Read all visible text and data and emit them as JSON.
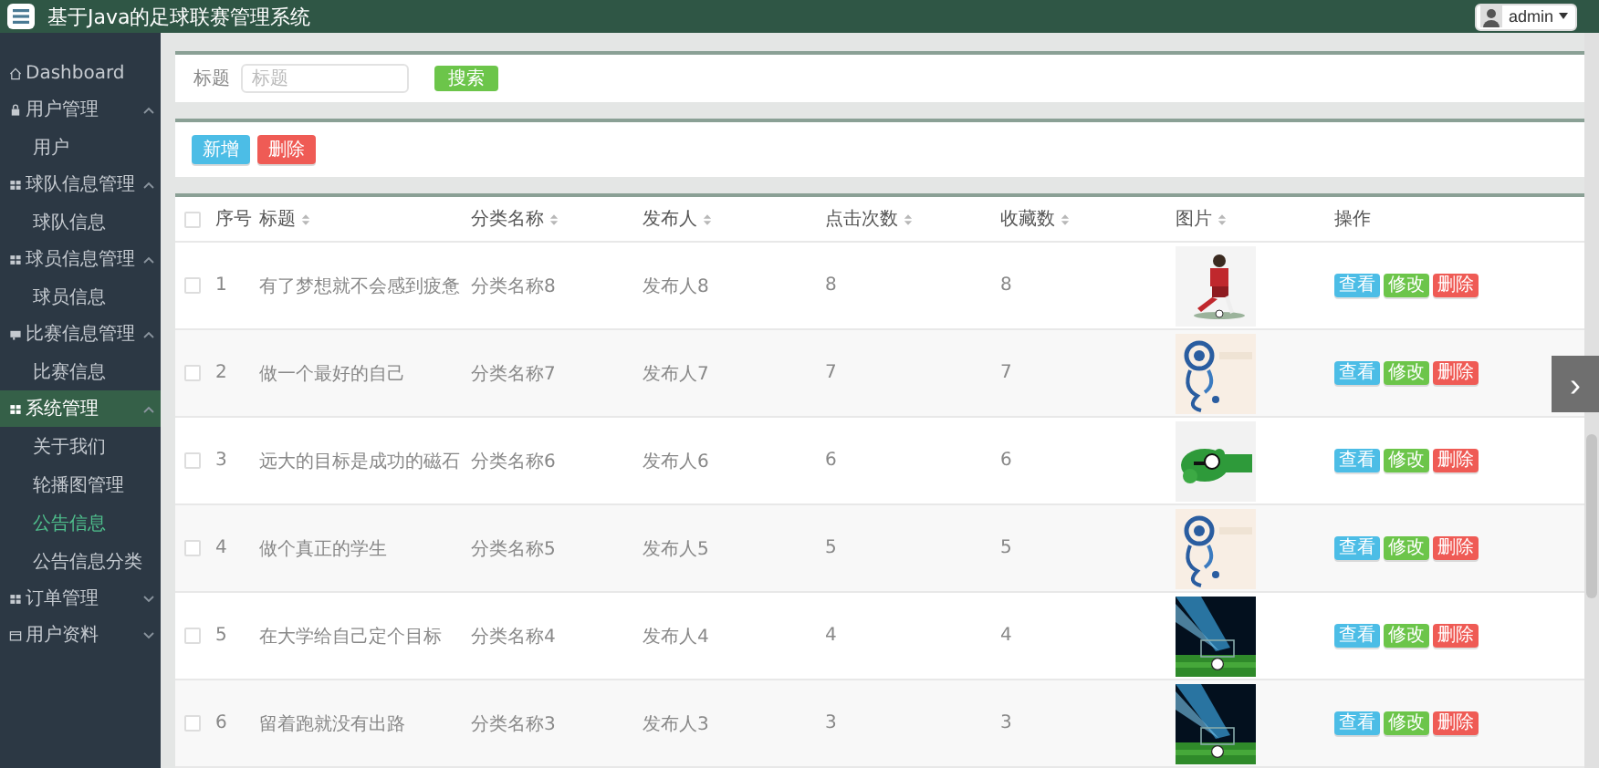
{
  "header": {
    "title": "基于Java的足球联赛管理系统",
    "user": "admin"
  },
  "sidebar": {
    "items": [
      {
        "label": "Dashboard",
        "kind": "home",
        "selected": false
      },
      {
        "label": "用户管理",
        "kind": "lock",
        "expanded": true,
        "selected": false,
        "children": [
          {
            "label": "用户",
            "selected": false
          }
        ]
      },
      {
        "label": "球队信息管理",
        "kind": "grid",
        "expanded": true,
        "selected": false,
        "children": [
          {
            "label": "球队信息",
            "selected": false
          }
        ]
      },
      {
        "label": "球员信息管理",
        "kind": "grid",
        "expanded": true,
        "selected": false,
        "children": [
          {
            "label": "球员信息",
            "selected": false
          }
        ]
      },
      {
        "label": "比赛信息管理",
        "kind": "card",
        "expanded": true,
        "selected": false,
        "children": [
          {
            "label": "比赛信息",
            "selected": false
          }
        ]
      },
      {
        "label": "系统管理",
        "kind": "grid",
        "expanded": true,
        "selected": true,
        "children": [
          {
            "label": "关于我们",
            "selected": false
          },
          {
            "label": "轮播图管理",
            "selected": false
          },
          {
            "label": "公告信息",
            "selected": true
          },
          {
            "label": "公告信息分类",
            "selected": false
          }
        ]
      },
      {
        "label": "订单管理",
        "kind": "grid",
        "expanded": false,
        "selected": false
      },
      {
        "label": "用户资料",
        "kind": "doc",
        "expanded": false,
        "selected": false
      }
    ]
  },
  "search": {
    "label": "标题",
    "placeholder": "标题",
    "button": "搜索"
  },
  "toolbar": [
    {
      "label": "新增",
      "kind": "add"
    },
    {
      "label": "删除",
      "kind": "delete"
    }
  ],
  "table": {
    "all_checked": false,
    "columns": [
      {
        "label": "序号",
        "sortable": false
      },
      {
        "label": "标题",
        "sortable": true
      },
      {
        "label": "分类名称",
        "sortable": true
      },
      {
        "label": "发布人",
        "sortable": true
      },
      {
        "label": "点击次数",
        "sortable": true
      },
      {
        "label": "收藏数",
        "sortable": true
      },
      {
        "label": "图片",
        "sortable": true
      },
      {
        "label": "操作",
        "sortable": false
      }
    ],
    "rows": [
      {
        "checked": false,
        "cells": [
          "1",
          "有了梦想就不会感到疲惫",
          "分类名称8",
          "发布人8",
          "8",
          "8"
        ],
        "image": {
          "kind": "picture"
        },
        "actions": [
          "查看",
          "修改",
          "删除"
        ]
      },
      {
        "checked": false,
        "cells": [
          "2",
          "做一个最好的自己",
          "分类名称7",
          "发布人7",
          "7",
          "7"
        ],
        "image": {
          "kind": "picture"
        },
        "actions": [
          "查看",
          "修改",
          "删除"
        ]
      },
      {
        "checked": false,
        "cells": [
          "3",
          "远大的目标是成功的磁石",
          "分类名称6",
          "发布人6",
          "6",
          "6"
        ],
        "image": {
          "kind": "picture"
        },
        "actions": [
          "查看",
          "修改",
          "删除"
        ]
      },
      {
        "checked": false,
        "cells": [
          "4",
          "做个真正的学生",
          "分类名称5",
          "发布人5",
          "5",
          "5"
        ],
        "image": {
          "kind": "picture"
        },
        "actions": [
          "查看",
          "修改",
          "删除"
        ]
      },
      {
        "checked": false,
        "cells": [
          "5",
          "在大学给自己定个目标",
          "分类名称4",
          "发布人4",
          "4",
          "4"
        ],
        "image": {
          "kind": "picture"
        },
        "actions": [
          "查看",
          "修改",
          "删除"
        ]
      },
      {
        "checked": false,
        "cells": [
          "6",
          "留着跑就没有出路",
          "分类名称3",
          "发布人3",
          "3",
          "3"
        ],
        "image": {
          "kind": "picture"
        },
        "actions": [
          "查看",
          "修改",
          "删除"
        ]
      }
    ]
  },
  "next_button": {
    "label": "›"
  }
}
